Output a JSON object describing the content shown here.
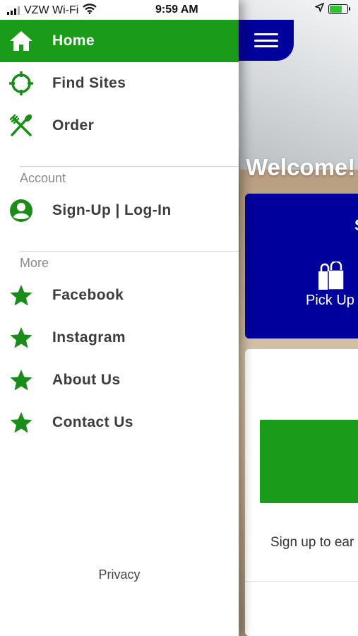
{
  "status_bar": {
    "carrier": "VZW Wi-Fi",
    "time": "9:59 AM"
  },
  "drawer": {
    "items": [
      {
        "label": "Home",
        "icon": "home-icon",
        "active": true
      },
      {
        "label": "Find Sites",
        "icon": "crosshair-icon"
      },
      {
        "label": "Order",
        "icon": "utensils-icon"
      }
    ],
    "account_section": {
      "title": "Account",
      "items": [
        {
          "label": "Sign-Up | Log-In",
          "icon": "user-circle-icon"
        }
      ]
    },
    "more_section": {
      "title": "More",
      "items": [
        {
          "label": "Facebook",
          "icon": "star-icon"
        },
        {
          "label": "Instagram",
          "icon": "star-icon"
        },
        {
          "label": "About Us",
          "icon": "star-icon"
        },
        {
          "label": "Contact Us",
          "icon": "star-icon"
        }
      ]
    },
    "footer_link": "Privacy"
  },
  "app": {
    "welcome_text": "Welcome!",
    "order_card_letter": "S",
    "pickup_label": "Pick Up",
    "signup_text": "Sign up to ear"
  },
  "colors": {
    "brand_green": "#1a9c1a",
    "brand_blue": "#00009c",
    "icon_green": "#1a8c1a"
  }
}
